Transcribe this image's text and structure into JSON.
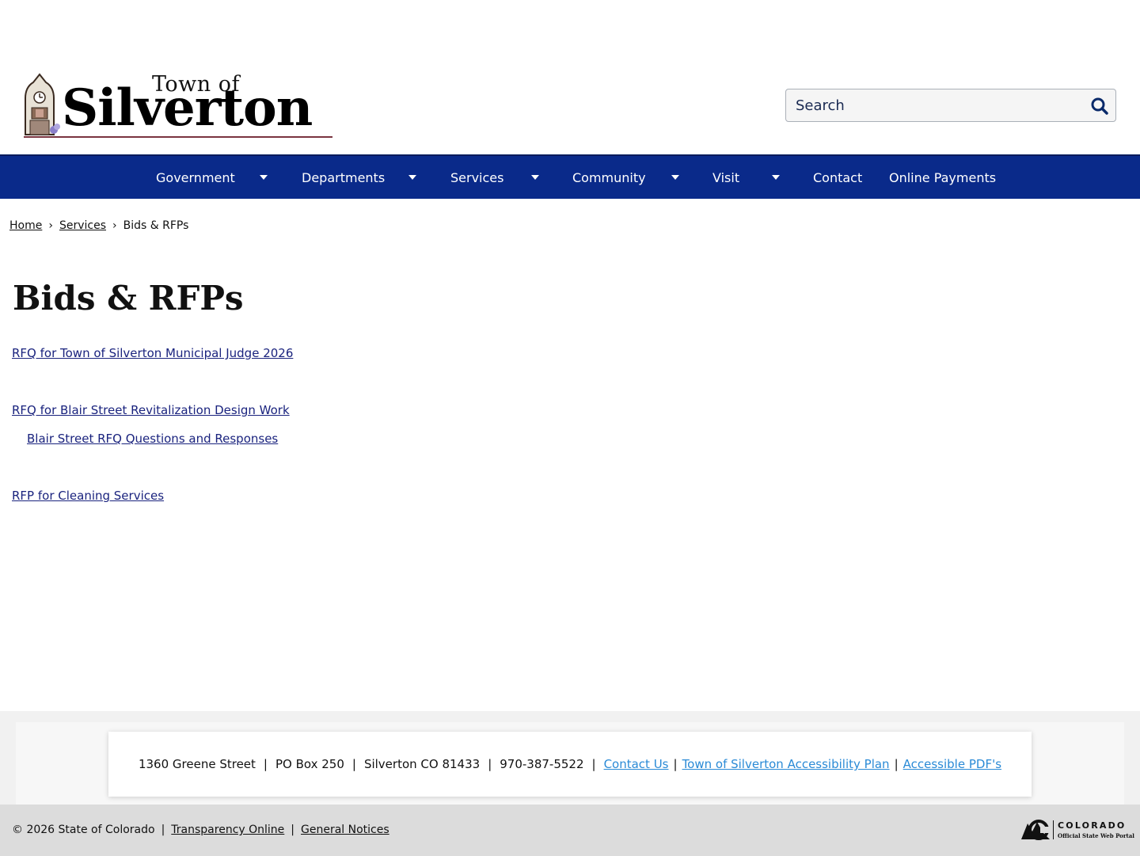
{
  "header": {
    "logo": {
      "line1": "Town of",
      "line2": "Silverton"
    },
    "search": {
      "placeholder": "Search"
    }
  },
  "nav": {
    "items": [
      {
        "label": "Government",
        "has_dropdown": true
      },
      {
        "label": "Departments",
        "has_dropdown": true
      },
      {
        "label": "Services",
        "has_dropdown": true
      },
      {
        "label": "Community",
        "has_dropdown": true
      },
      {
        "label": "Visit",
        "has_dropdown": true
      },
      {
        "label": "Contact",
        "has_dropdown": false
      },
      {
        "label": "Online Payments",
        "has_dropdown": false
      }
    ]
  },
  "breadcrumb": {
    "home": "Home",
    "services": "Services",
    "current": "Bids & RFPs",
    "separator": "›"
  },
  "main": {
    "title": "Bids & RFPs",
    "links": [
      "RFQ for Town of Silverton Municipal Judge 2026",
      "RFQ for Blair Street Revitalization Design Work",
      " Blair Street RFQ Questions and Responses",
      "RFP for Cleaning Services"
    ]
  },
  "footer": {
    "address": "1360 Greene Street",
    "po_box": "PO Box 250",
    "city": "Silverton CO 81433",
    "phone": "970-387-5522",
    "contact_link": "Contact Us",
    "accessibility_link": "Town of Silverton Accessibility Plan",
    "pdf_link": "Accessible PDF's",
    "pipe": "|"
  },
  "bottom": {
    "copyright": "© 2026 State of Colorado",
    "transparency": "Transparency Online",
    "notices": "General Notices",
    "pipe": "|",
    "colorado_logo": {
      "word": "COLORADO",
      "tag": "Official State Web Portal"
    }
  },
  "colors": {
    "nav_bg": "#0a2a8a",
    "link": "#1a237e",
    "footer_link": "#2a8ad6",
    "logo_rule": "#7a3440"
  }
}
